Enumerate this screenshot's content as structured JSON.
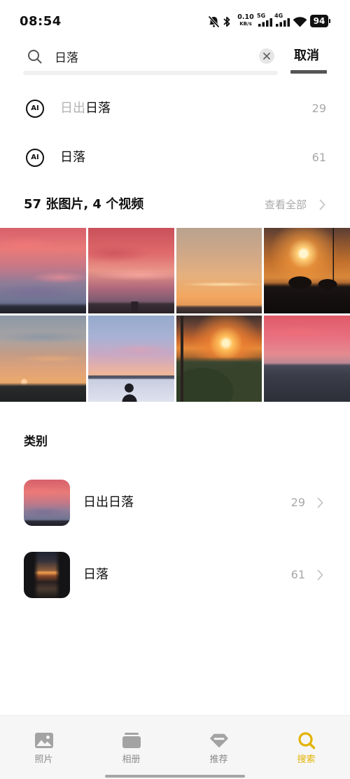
{
  "status_bar": {
    "time": "08:54",
    "net_speed_value": "0.10",
    "net_speed_unit": "KB/s",
    "sim1_label": "5G",
    "sim2_label": "4G",
    "battery": "94",
    "icons": [
      "bell-off-icon",
      "bluetooth-icon",
      "signal-icon",
      "wifi-icon",
      "battery-icon"
    ]
  },
  "search": {
    "query": "日落",
    "cancel_label": "取消"
  },
  "suggestions": [
    {
      "icon_label": "AI",
      "prefix": "日出",
      "match": "日落",
      "count": "29"
    },
    {
      "icon_label": "AI",
      "prefix": "",
      "match": "日落",
      "count": "61"
    }
  ],
  "results": {
    "summary": "57 张图片, 4 个视频",
    "view_all_label": "查看全部"
  },
  "categories": {
    "heading": "类别",
    "items": [
      {
        "label": "日出日落",
        "count": "29"
      },
      {
        "label": "日落",
        "count": "61"
      }
    ]
  },
  "bottom_nav": {
    "items": [
      {
        "label": "照片",
        "icon": "photo-icon",
        "active": false
      },
      {
        "label": "相册",
        "icon": "album-icon",
        "active": false
      },
      {
        "label": "推荐",
        "icon": "recommend-icon",
        "active": false
      },
      {
        "label": "搜索",
        "icon": "search-icon",
        "active": true
      }
    ]
  },
  "colors": {
    "accent": "#e3b300",
    "text_primary": "#111111",
    "text_secondary": "#a8a8a8"
  }
}
